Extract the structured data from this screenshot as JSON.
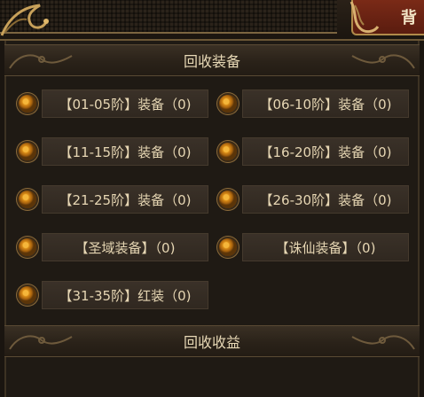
{
  "header": {
    "tab_label": "背"
  },
  "sections": {
    "recycle_equipment": "回收装备",
    "recycle_income": "回收收益"
  },
  "items": [
    {
      "label": "【01-05阶】装备（0)"
    },
    {
      "label": "【06-10阶】装备（0)"
    },
    {
      "label": "【11-15阶】装备（0)"
    },
    {
      "label": "【16-20阶】装备（0)"
    },
    {
      "label": "【21-25阶】装备（0)"
    },
    {
      "label": "【26-30阶】装备（0)"
    },
    {
      "label": "【圣域装备】（0)"
    },
    {
      "label": "【诛仙装备】（0)"
    },
    {
      "label": "【31-35阶】红装（0)"
    }
  ],
  "colors": {
    "accent": "#d98b17",
    "tab_red": "#7a2a17",
    "text": "#e6d6b3"
  }
}
